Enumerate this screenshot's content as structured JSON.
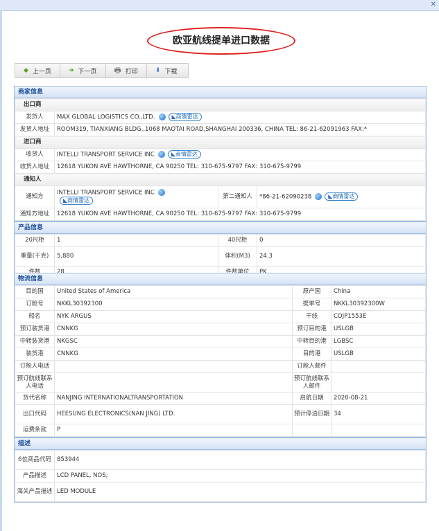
{
  "title": "欧亚航线提单进口数据",
  "toolbar": {
    "prev": "上一页",
    "next": "下一页",
    "print": "打印",
    "download": "下载"
  },
  "radar_label": "商情雷达",
  "merchant": {
    "header": "商家信息",
    "exporter": "出口商",
    "shipper_l": "发货人",
    "shipper": "MAX GLOBAL LOGISTICS CO.,LTD.",
    "shipper_addr_l": "发货人地址",
    "shipper_addr": "ROOM319, TIANXIANG BLDG.,1068 MAOTAI ROAD,SHANGHAI 200336, CHINA TEL: 86-21-62091963 FAX:*",
    "importer": "进口商",
    "consignee_l": "收货人",
    "consignee": "INTELLI TRANSPORT SERVICE INC",
    "consignee_addr_l": "收货人地址",
    "consignee_addr": "12618 YUKON AVE HAWTHORNE, CA 90250 TEL: 310-675-9797 FAX: 310-675-9799",
    "notify": "通知人",
    "notify_l": "通知方",
    "notify_party": "INTELLI TRANSPORT SERVICE INC",
    "second_l": "第二通知人",
    "second": "*86-21-62090238",
    "notify_addr_l": "通知方地址",
    "notify_addr": "12618 YUKON AVE HAWTHORNE, CA 90250 TEL: 310-675-9797 FAX: 310-675-9799"
  },
  "product": {
    "header": "产品信息",
    "rows": [
      {
        "l1": "20尺柜",
        "v1": "1",
        "l2": "40尺柜",
        "v2": "0"
      },
      {
        "l1": "重量(千克)",
        "v1": "5,880",
        "l2": "体积(M3)",
        "v2": "24.3"
      },
      {
        "l1": "件数",
        "v1": "28",
        "l2": "件数单位",
        "v2": "PK"
      }
    ]
  },
  "logistics": {
    "header": "物流信息",
    "rows": [
      {
        "l1": "目的国",
        "v1": "United States of America",
        "l2": "原产国",
        "v2": "China"
      },
      {
        "l1": "订舱号",
        "v1": "NKKL30392300",
        "l2": "提单号",
        "v2": "NKKL30392300W"
      },
      {
        "l1": "船名",
        "v1": "NYK ARGUS",
        "l2": "干线",
        "v2": "COJP1553E"
      },
      {
        "l1": "预订装货港",
        "v1": "CNNKG",
        "l2": "预订目的港",
        "v2": "USLGB"
      },
      {
        "l1": "中转装货港",
        "v1": "NKGSC",
        "l2": "中转目的港",
        "v2": "LGBSC"
      },
      {
        "l1": "装货港",
        "v1": "CNNKG",
        "l2": "目的港",
        "v2": "USLGB"
      },
      {
        "l1": "订舱人电话",
        "v1": "",
        "l2": "订舱人邮件",
        "v2": ""
      },
      {
        "l1": "预订航线联系人电话",
        "v1": "",
        "l2": "预订航线联系人邮件",
        "v2": ""
      },
      {
        "l1": "货代名称",
        "v1": "NANJING INTERNATIONALTRANSPORTATION",
        "l2": "启航日期",
        "v2": "2020-08-21"
      },
      {
        "l1": "出口代码",
        "v1": "HEESUNG ELECTRONICS(NAN JING) LTD.",
        "l2": "预计停泊日期",
        "v2": "34"
      },
      {
        "l1": "运费条款",
        "v1": "P",
        "l2": "",
        "v2": ""
      }
    ]
  },
  "description": {
    "header": "描述",
    "rows": [
      {
        "l": "6位商品代码",
        "v": "853944"
      },
      {
        "l": "产品描述",
        "v": "LCD PANEL, NOS;"
      },
      {
        "l": "海关产品描述",
        "v": "LED MODULE"
      }
    ]
  }
}
